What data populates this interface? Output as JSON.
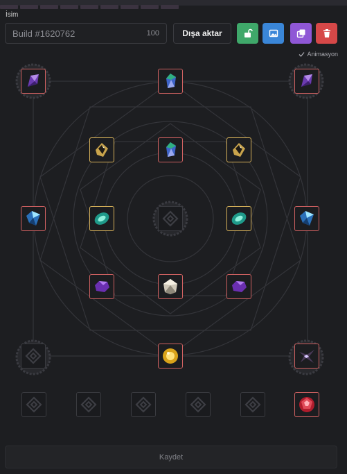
{
  "name_label": "İsim",
  "build_name": "Build #1620762",
  "char_limit": "100",
  "export_label": "Dışa aktar",
  "actions": [
    {
      "icon": "unlock-icon",
      "color": "#3fa86a"
    },
    {
      "icon": "image-icon",
      "color": "#3a86d8"
    },
    {
      "icon": "copy-icon",
      "color": "#8f57d6"
    },
    {
      "icon": "trash-icon",
      "color": "#d64848"
    }
  ],
  "animation_label": "Animasyon",
  "animation_enabled": true,
  "save_label": "Kaydet",
  "slots": [
    {
      "id": "top-left",
      "gem": "purple-crystal-icon",
      "frame": "red"
    },
    {
      "id": "top-center",
      "gem": "blue-green-crystal-icon",
      "frame": "red"
    },
    {
      "id": "top-right",
      "gem": "purple-crystal-icon",
      "frame": "red"
    },
    {
      "id": "inner-top-left",
      "gem": "gold-black-gem-icon",
      "frame": "gold"
    },
    {
      "id": "inner-top-center",
      "gem": "blue-green-crystal-icon",
      "frame": "red"
    },
    {
      "id": "inner-top-right",
      "gem": "gold-black-gem-icon",
      "frame": "gold"
    },
    {
      "id": "mid-left",
      "gem": "blue-shard-icon",
      "frame": "red"
    },
    {
      "id": "mid-inner-left",
      "gem": "teal-rune-icon",
      "frame": "gold"
    },
    {
      "id": "center",
      "gem": "empty-socket-icon",
      "frame": "empty"
    },
    {
      "id": "mid-inner-right",
      "gem": "teal-rune-icon",
      "frame": "gold"
    },
    {
      "id": "mid-right",
      "gem": "blue-shard-icon",
      "frame": "red"
    },
    {
      "id": "lower-left",
      "gem": "purple-hexagon-gem-icon",
      "frame": "red"
    },
    {
      "id": "lower-center",
      "gem": "white-diamond-icon",
      "frame": "red"
    },
    {
      "id": "lower-right",
      "gem": "purple-hexagon-gem-icon",
      "frame": "red"
    },
    {
      "id": "bottom-left",
      "gem": "empty-socket-icon",
      "frame": "empty"
    },
    {
      "id": "bottom-center",
      "gem": "golden-orb-icon",
      "frame": "red"
    },
    {
      "id": "bottom-right",
      "gem": "dark-star-gem-icon",
      "frame": "red"
    }
  ],
  "inventory": [
    {
      "gem": "empty-socket-icon"
    },
    {
      "gem": "empty-socket-icon"
    },
    {
      "gem": "empty-socket-icon"
    },
    {
      "gem": "empty-socket-icon"
    },
    {
      "gem": "empty-socket-icon"
    },
    {
      "gem": "red-faceted-gem-icon"
    }
  ]
}
